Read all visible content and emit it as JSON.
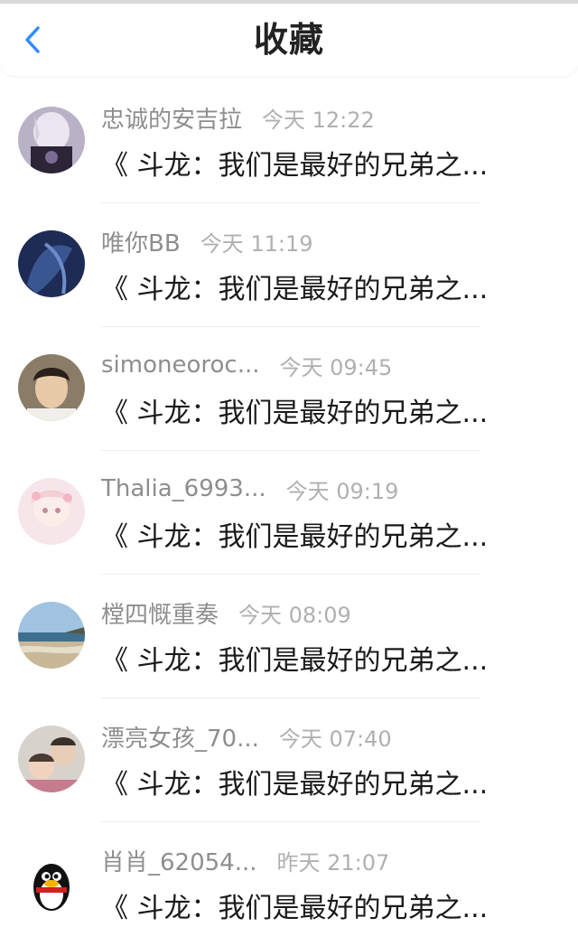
{
  "header": {
    "title": "收藏",
    "back_icon": "chevron-left-icon",
    "accent": "#2f8cff"
  },
  "items": [
    {
      "name": "忠诚的安吉拉",
      "time": "今天 12:22",
      "message": "《 斗龙：我们是最好的兄弟之..."
    },
    {
      "name": "唯你BB",
      "time": "今天 11:19",
      "message": "《 斗龙：我们是最好的兄弟之..."
    },
    {
      "name": "simoneoroc...",
      "time": "今天 09:45",
      "message": "《 斗龙：我们是最好的兄弟之..."
    },
    {
      "name": "Thalia_6993...",
      "time": "今天 09:19",
      "message": "《 斗龙：我们是最好的兄弟之..."
    },
    {
      "name": "樘四慨重奏",
      "time": "今天 08:09",
      "message": "《 斗龙：我们是最好的兄弟之..."
    },
    {
      "name": "漂亮女孩_70...",
      "time": "今天 07:40",
      "message": "《 斗龙：我们是最好的兄弟之..."
    },
    {
      "name": "肖肖_62054...",
      "time": "昨天 21:07",
      "message": "《 斗龙：我们是最好的兄弟之..."
    }
  ]
}
